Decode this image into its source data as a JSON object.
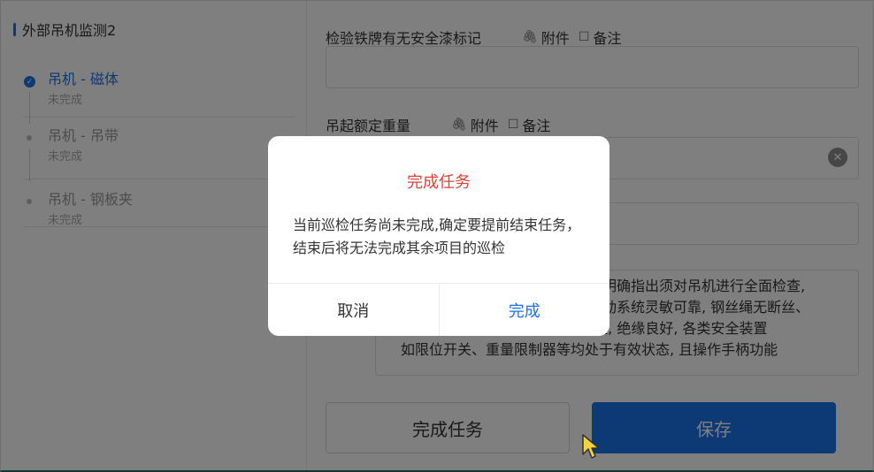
{
  "sidebar": {
    "title": "外部吊机监测2",
    "steps": [
      {
        "name": "吊机 - 磁体",
        "status": "未完成",
        "active": true
      },
      {
        "name": "吊机 - 吊带",
        "status": "未完成",
        "active": false
      },
      {
        "name": "吊机 - 钢板夹",
        "status": "未完成",
        "active": false
      }
    ]
  },
  "main": {
    "fields": [
      {
        "label": "检验铁牌有无安全漆标记",
        "attach": "附件",
        "note": "备注"
      },
      {
        "label": "吊起额定重量",
        "attach": "附件",
        "note": "备注"
      }
    ],
    "textarea_lines": [
      "明确指出须对吊机进行全面检查,",
      "动系统灵敏可靠, 钢丝绳无断丝、",
      "磨损现象, 电气控制系统线路完整, 绝缘良好, 各类安全装置",
      "如限位开关、重量限制器等均处于有效状态, 且操作手柄功能"
    ],
    "finish_button": "完成任务",
    "save_button": "保存"
  },
  "dialog": {
    "title": "完成任务",
    "message": "当前巡检任务尚未完成,确定要提前结束任务，结束后将无法完成其余项目的巡检",
    "cancel": "取消",
    "confirm": "完成"
  },
  "colors": {
    "accent": "#1a73e8",
    "danger": "#e0413b"
  },
  "icons": {
    "attach": "paperclip-icon",
    "note": "edit-note-icon",
    "clear": "clear-icon",
    "step_done": "check-circle-icon"
  }
}
